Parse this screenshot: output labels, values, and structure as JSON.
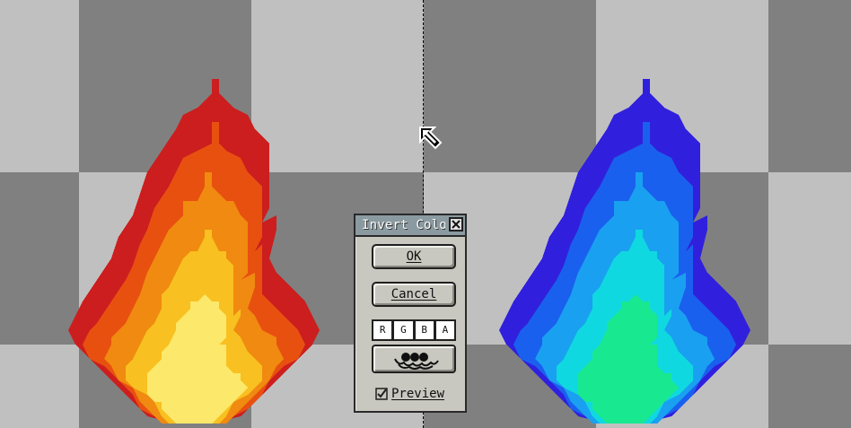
{
  "canvas": {
    "checker_colors": [
      "#808080",
      "#c0c0c0"
    ],
    "original_flame_colors": [
      "#cc1e1e",
      "#e85010",
      "#f08a10",
      "#f8c020",
      "#fce86a"
    ],
    "inverted_flame_colors": [
      "#3020dd",
      "#1a60ee",
      "#1aa0f0",
      "#10d8e0",
      "#18e890"
    ]
  },
  "dialog": {
    "title": "Invert Color",
    "close_icon": "close-icon",
    "ok_label": "OK",
    "cancel_label": "Cancel",
    "channels": [
      "R",
      "G",
      "B",
      "A"
    ],
    "target_icon": "layers-target-icon",
    "preview_label": "Preview",
    "preview_checked": true
  }
}
